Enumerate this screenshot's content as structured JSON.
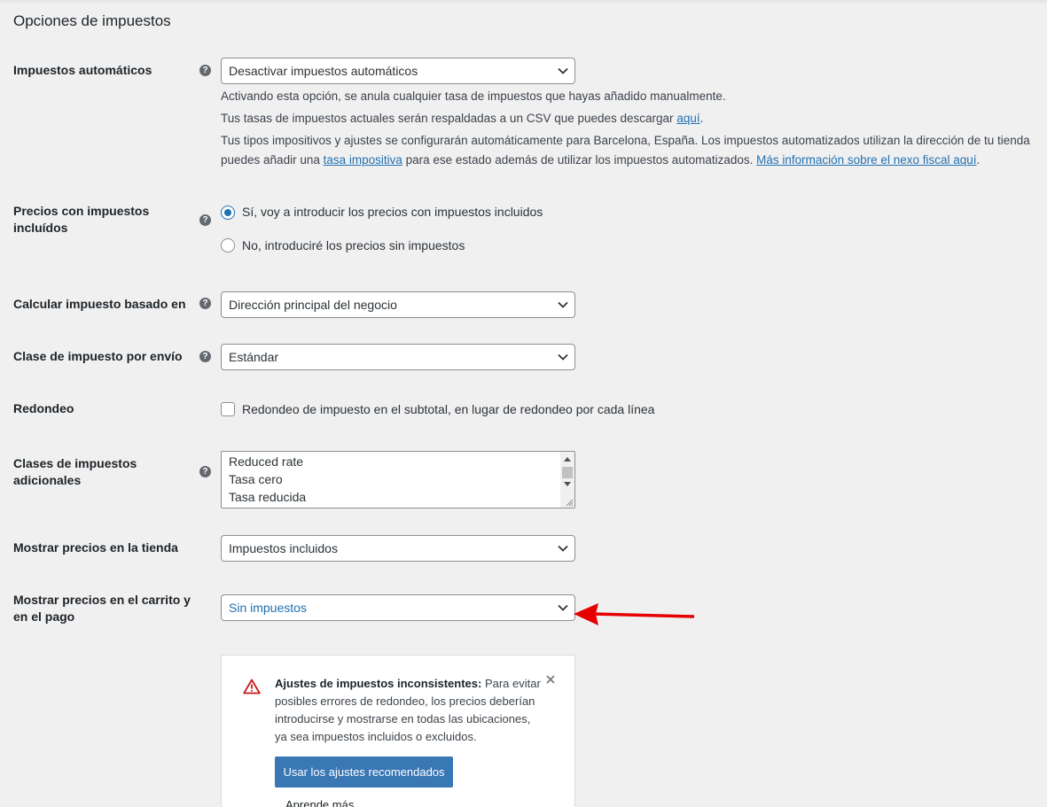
{
  "section": {
    "title": "Opciones de impuestos"
  },
  "help_icon_glyph": "?",
  "automatic": {
    "label": "Impuestos automáticos",
    "value": "Desactivar impuestos automáticos",
    "desc1": "Activando esta opción, se anula cualquier tasa de impuestos que hayas añadido manualmente.",
    "desc2_pre": "Tus tasas de impuestos actuales serán respaldadas a un CSV que puedes descargar ",
    "desc2_link": "aquí",
    "desc2_post": ".",
    "desc3": "Tus tipos impositivos y ajustes se configurarán automáticamente para Barcelona, España. Los impuestos automatizados utilizan la dirección de tu tienda",
    "desc4_pre": "puedes añadir una ",
    "desc4_link1": "tasa impositiva",
    "desc4_mid": " para ese estado además de utilizar los impuestos automatizados. ",
    "desc4_link2": "Más información sobre el nexo fiscal aquí",
    "desc4_post": "."
  },
  "prices_include_tax": {
    "label": "Precios con impuestos incluídos",
    "option_yes": "Sí, voy a introducir los precios con impuestos incluidos",
    "option_no": "No, introduciré los precios sin impuestos",
    "selected": "yes"
  },
  "tax_based_on": {
    "label": "Calcular impuesto basado en",
    "value": "Dirección principal del negocio"
  },
  "shipping_tax_class": {
    "label": "Clase de impuesto por envío",
    "value": "Estándar"
  },
  "rounding": {
    "label": "Redondeo",
    "option": "Redondeo de impuesto en el subtotal, en lugar de redondeo por cada línea",
    "checked": false
  },
  "additional_classes": {
    "label": "Clases de impuestos adicionales",
    "lines": [
      "Reduced rate",
      "Tasa cero",
      "Tasa reducida"
    ]
  },
  "display_shop": {
    "label": "Mostrar precios en la tienda",
    "value": "Impuestos incluidos"
  },
  "display_cart": {
    "label": "Mostrar precios en el carrito y en el pago",
    "value": "Sin impuestos"
  },
  "notice": {
    "title": "Ajustes de impuestos inconsistentes:",
    "body": " Para evitar posibles errores de redondeo, los precios deberían introducirse y mostrarse en todas las ubicaciones, ya sea impuestos incluidos o excluidos.",
    "button": "Usar los ajustes recomendados",
    "learn_more": "Aprende más"
  },
  "colors": {
    "accent": "#2271b1",
    "arrow": "#e60000",
    "button": "#3a77b5"
  }
}
